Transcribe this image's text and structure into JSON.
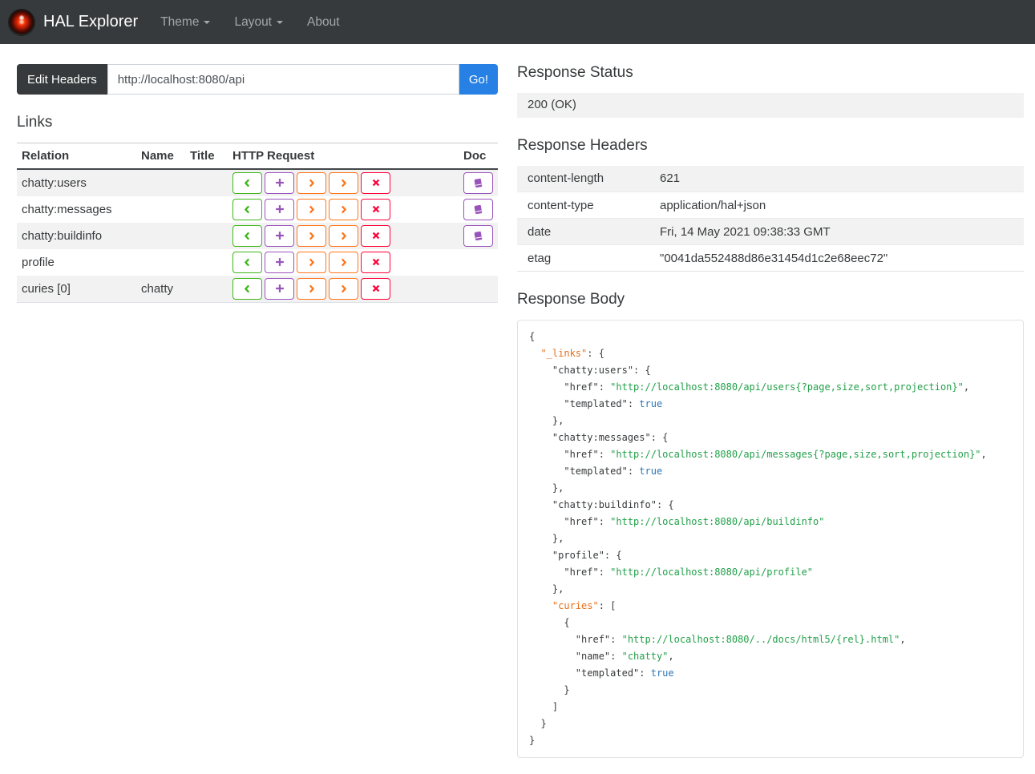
{
  "navbar": {
    "brand": "HAL Explorer",
    "items": [
      {
        "label": "Theme",
        "caret": true
      },
      {
        "label": "Layout",
        "caret": true
      },
      {
        "label": "About",
        "caret": false
      }
    ]
  },
  "request_bar": {
    "edit_headers_label": "Edit Headers",
    "url_value": "http://localhost:8080/api",
    "go_label": "Go!"
  },
  "links": {
    "title": "Links",
    "columns": {
      "relation": "Relation",
      "name": "Name",
      "title": "Title",
      "http_request": "HTTP Request",
      "doc": "Doc"
    },
    "http_buttons": [
      {
        "name": "get",
        "icon": "chevron-left-icon",
        "color": "#3fb618"
      },
      {
        "name": "post",
        "icon": "plus-icon",
        "color": "#9954bb"
      },
      {
        "name": "put",
        "icon": "chevron-right-icon",
        "color": "#ff7518"
      },
      {
        "name": "patch",
        "icon": "chevron-right-icon",
        "color": "#ff7518"
      },
      {
        "name": "delete",
        "icon": "x-icon",
        "color": "#ff0039"
      }
    ],
    "doc_color": "#9954bb",
    "rows": [
      {
        "relation": "chatty:users",
        "name": "",
        "title": "",
        "doc": true
      },
      {
        "relation": "chatty:messages",
        "name": "",
        "title": "",
        "doc": true
      },
      {
        "relation": "chatty:buildinfo",
        "name": "",
        "title": "",
        "doc": true
      },
      {
        "relation": "profile",
        "name": "",
        "title": "",
        "doc": false
      },
      {
        "relation": "curies [0]",
        "name": "chatty",
        "title": "",
        "doc": false
      }
    ]
  },
  "response_status": {
    "title": "Response Status",
    "value": "200 (OK)"
  },
  "response_headers": {
    "title": "Response Headers",
    "rows": [
      {
        "name": "content-length",
        "value": "621"
      },
      {
        "name": "content-type",
        "value": "application/hal+json"
      },
      {
        "name": "date",
        "value": "Fri, 14 May 2021 09:38:33 GMT"
      },
      {
        "name": "etag",
        "value": "\"0041da552488d86e31454d1c2e68eec72\""
      }
    ]
  },
  "response_body": {
    "title": "Response Body",
    "syntax_colors": {
      "plain": "#373a3c",
      "key": "#e8701a",
      "string": "#22a049",
      "literal": "#2e77b5"
    },
    "lines": [
      [
        [
          "p",
          "{"
        ]
      ],
      [
        [
          "p",
          "  "
        ],
        [
          "k",
          "\"_links\""
        ],
        [
          "p",
          ": {"
        ]
      ],
      [
        [
          "p",
          "    \"chatty:users\": {"
        ]
      ],
      [
        [
          "p",
          "      \"href\": "
        ],
        [
          "s",
          "\"http://localhost:8080/api/users{?page,size,sort,projection}\""
        ],
        [
          "p",
          ","
        ]
      ],
      [
        [
          "p",
          "      \"templated\": "
        ],
        [
          "b",
          "true"
        ]
      ],
      [
        [
          "p",
          "    },"
        ]
      ],
      [
        [
          "p",
          "    \"chatty:messages\": {"
        ]
      ],
      [
        [
          "p",
          "      \"href\": "
        ],
        [
          "s",
          "\"http://localhost:8080/api/messages{?page,size,sort,projection}\""
        ],
        [
          "p",
          ","
        ]
      ],
      [
        [
          "p",
          "      \"templated\": "
        ],
        [
          "b",
          "true"
        ]
      ],
      [
        [
          "p",
          "    },"
        ]
      ],
      [
        [
          "p",
          "    \"chatty:buildinfo\": {"
        ]
      ],
      [
        [
          "p",
          "      \"href\": "
        ],
        [
          "s",
          "\"http://localhost:8080/api/buildinfo\""
        ]
      ],
      [
        [
          "p",
          "    },"
        ]
      ],
      [
        [
          "p",
          "    \"profile\": {"
        ]
      ],
      [
        [
          "p",
          "      \"href\": "
        ],
        [
          "s",
          "\"http://localhost:8080/api/profile\""
        ]
      ],
      [
        [
          "p",
          "    },"
        ]
      ],
      [
        [
          "p",
          "    "
        ],
        [
          "k",
          "\"curies\""
        ],
        [
          "p",
          ": ["
        ]
      ],
      [
        [
          "p",
          "      {"
        ]
      ],
      [
        [
          "p",
          "        \"href\": "
        ],
        [
          "s",
          "\"http://localhost:8080/../docs/html5/{rel}.html\""
        ],
        [
          "p",
          ","
        ]
      ],
      [
        [
          "p",
          "        \"name\": "
        ],
        [
          "s",
          "\"chatty\""
        ],
        [
          "p",
          ","
        ]
      ],
      [
        [
          "p",
          "        \"templated\": "
        ],
        [
          "b",
          "true"
        ]
      ],
      [
        [
          "p",
          "      }"
        ]
      ],
      [
        [
          "p",
          "    ]"
        ]
      ],
      [
        [
          "p",
          "  }"
        ]
      ],
      [
        [
          "p",
          "}"
        ]
      ]
    ]
  },
  "colors": {
    "primary": "#2780e3",
    "navbar_bg": "#373a3c",
    "success": "#3fb618",
    "info_purple": "#9954bb",
    "warning_orange": "#ff7518",
    "danger": "#ff0039"
  }
}
